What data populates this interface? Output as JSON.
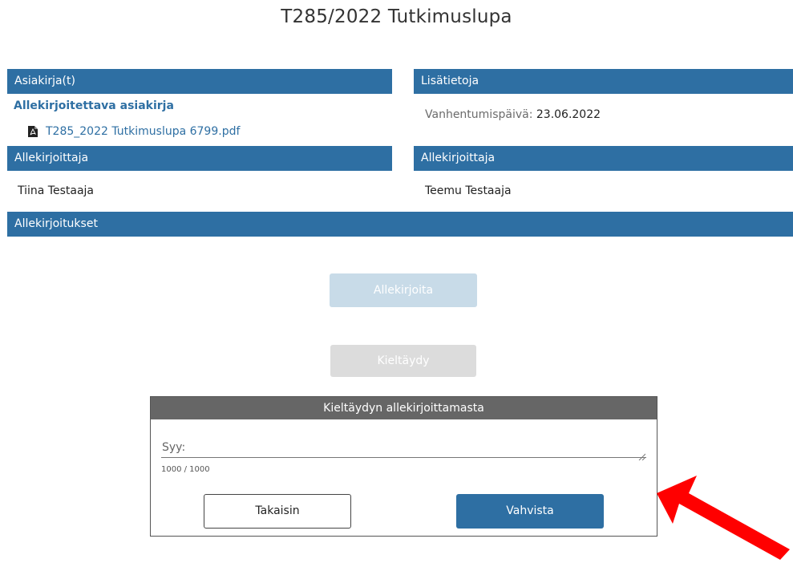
{
  "title": "T285/2022 Tutkimuslupa",
  "documents": {
    "header": "Asiakirja(t)",
    "subheading": "Allekirjoitettava asiakirja",
    "file_name": "T285_2022 Tutkimuslupa 6799.pdf",
    "file_icon": "pdf-file-icon"
  },
  "info": {
    "header": "Lisätietoja",
    "expiry_label": "Vanhentumispäivä:",
    "expiry_value": "23.06.2022"
  },
  "signers": [
    {
      "header": "Allekirjoittaja",
      "name": "Tiina Testaaja"
    },
    {
      "header": "Allekirjoittaja",
      "name": "Teemu Testaaja"
    }
  ],
  "signatures": {
    "header": "Allekirjoitukset"
  },
  "actions": {
    "sign_label": "Allekirjoita",
    "decline_label": "Kieltäydy"
  },
  "decline_dialog": {
    "title": "Kieltäydyn allekirjoittamasta",
    "reason_placeholder": "Syy:",
    "counter": "1000 / 1000",
    "back_label": "Takaisin",
    "confirm_label": "Vahvista"
  },
  "colors": {
    "primary": "#2e6fa3",
    "dialog_header": "#666666",
    "annotation_arrow": "#ff0000"
  }
}
